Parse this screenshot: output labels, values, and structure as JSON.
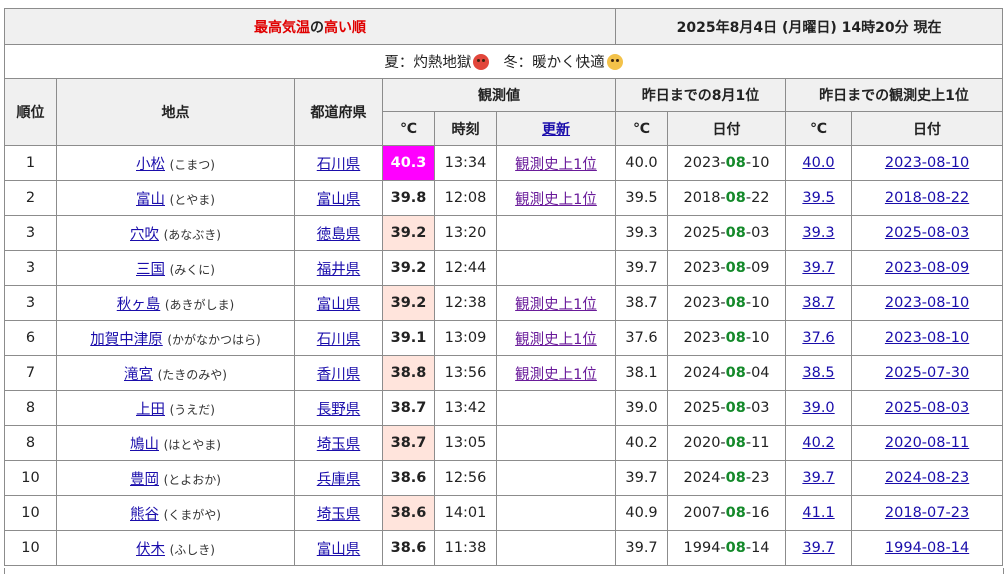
{
  "header": {
    "title_part1": "最高気温",
    "title_part2": "の",
    "title_part3": "高い順",
    "datetime": "2025年8月4日 (月曜日) 14時20分 現在"
  },
  "note": {
    "summer": "夏：灼熱地獄",
    "winter": "冬：暖かく快適"
  },
  "columns": {
    "rank": "順位",
    "location": "地点",
    "prefecture": "都道府県",
    "observed": "観測値",
    "observed_temp": "℃",
    "observed_time": "時刻",
    "observed_update": "更新",
    "month_record": "昨日までの8月1位",
    "month_temp": "℃",
    "month_date": "日付",
    "all_record": "昨日までの観測史上1位",
    "all_temp": "℃",
    "all_date": "日付"
  },
  "rows": [
    {
      "rank": "1",
      "name": "小松",
      "reading": "(こまつ)",
      "pref": "石川県",
      "temp": "40.3",
      "time": "13:34",
      "update": "観測史上1位",
      "m_temp": "40.0",
      "m_y": "2023-",
      "m_m": "08",
      "m_d": "-10",
      "a_temp": "40.0",
      "a_date": "2023-08-10"
    },
    {
      "rank": "2",
      "name": "富山",
      "reading": "(とやま)",
      "pref": "富山県",
      "temp": "39.8",
      "time": "12:08",
      "update": "観測史上1位",
      "m_temp": "39.5",
      "m_y": "2018-",
      "m_m": "08",
      "m_d": "-22",
      "a_temp": "39.5",
      "a_date": "2018-08-22"
    },
    {
      "rank": "3",
      "name": "穴吹",
      "reading": "(あなぶき)",
      "pref": "徳島県",
      "temp": "39.2",
      "time": "13:20",
      "update": "",
      "m_temp": "39.3",
      "m_y": "2025-",
      "m_m": "08",
      "m_d": "-03",
      "a_temp": "39.3",
      "a_date": "2025-08-03"
    },
    {
      "rank": "3",
      "name": "三国",
      "reading": "(みくに)",
      "pref": "福井県",
      "temp": "39.2",
      "time": "12:44",
      "update": "",
      "m_temp": "39.7",
      "m_y": "2023-",
      "m_m": "08",
      "m_d": "-09",
      "a_temp": "39.7",
      "a_date": "2023-08-09"
    },
    {
      "rank": "3",
      "name": "秋ヶ島",
      "reading": "(あきがしま)",
      "pref": "富山県",
      "temp": "39.2",
      "time": "12:38",
      "update": "観測史上1位",
      "m_temp": "38.7",
      "m_y": "2023-",
      "m_m": "08",
      "m_d": "-10",
      "a_temp": "38.7",
      "a_date": "2023-08-10"
    },
    {
      "rank": "6",
      "name": "加賀中津原",
      "reading": "(かがなかつはら)",
      "pref": "石川県",
      "temp": "39.1",
      "time": "13:09",
      "update": "観測史上1位",
      "m_temp": "37.6",
      "m_y": "2023-",
      "m_m": "08",
      "m_d": "-10",
      "a_temp": "37.6",
      "a_date": "2023-08-10"
    },
    {
      "rank": "7",
      "name": "滝宮",
      "reading": "(たきのみや)",
      "pref": "香川県",
      "temp": "38.8",
      "time": "13:56",
      "update": "観測史上1位",
      "m_temp": "38.1",
      "m_y": "2024-",
      "m_m": "08",
      "m_d": "-04",
      "a_temp": "38.5",
      "a_date": "2025-07-30"
    },
    {
      "rank": "8",
      "name": "上田",
      "reading": "(うえだ)",
      "pref": "長野県",
      "temp": "38.7",
      "time": "13:42",
      "update": "",
      "m_temp": "39.0",
      "m_y": "2025-",
      "m_m": "08",
      "m_d": "-03",
      "a_temp": "39.0",
      "a_date": "2025-08-03"
    },
    {
      "rank": "8",
      "name": "鳩山",
      "reading": "(はとやま)",
      "pref": "埼玉県",
      "temp": "38.7",
      "time": "13:05",
      "update": "",
      "m_temp": "40.2",
      "m_y": "2020-",
      "m_m": "08",
      "m_d": "-11",
      "a_temp": "40.2",
      "a_date": "2020-08-11"
    },
    {
      "rank": "10",
      "name": "豊岡",
      "reading": "(とよおか)",
      "pref": "兵庫県",
      "temp": "38.6",
      "time": "12:56",
      "update": "",
      "m_temp": "39.7",
      "m_y": "2024-",
      "m_m": "08",
      "m_d": "-23",
      "a_temp": "39.7",
      "a_date": "2024-08-23"
    },
    {
      "rank": "10",
      "name": "熊谷",
      "reading": "(くまがや)",
      "pref": "埼玉県",
      "temp": "38.6",
      "time": "14:01",
      "update": "",
      "m_temp": "40.9",
      "m_y": "2007-",
      "m_m": "08",
      "m_d": "-16",
      "a_temp": "41.1",
      "a_date": "2018-07-23"
    },
    {
      "rank": "10",
      "name": "伏木",
      "reading": "(ふしき)",
      "pref": "富山県",
      "temp": "38.6",
      "time": "11:38",
      "update": "",
      "m_temp": "39.7",
      "m_y": "1994-",
      "m_m": "08",
      "m_d": "-14",
      "a_temp": "39.7",
      "a_date": "1994-08-14"
    }
  ],
  "colors": {
    "accent_red": "#e00000",
    "record_highlight": "#ff00ff",
    "temp_cell": "#ffe4dc",
    "month_green": "#14892a",
    "link": "#1a0dab",
    "visited_link": "#6a1b9a"
  },
  "icons": {
    "summer": "hot-face-icon",
    "winter": "smiling-face-icon"
  }
}
